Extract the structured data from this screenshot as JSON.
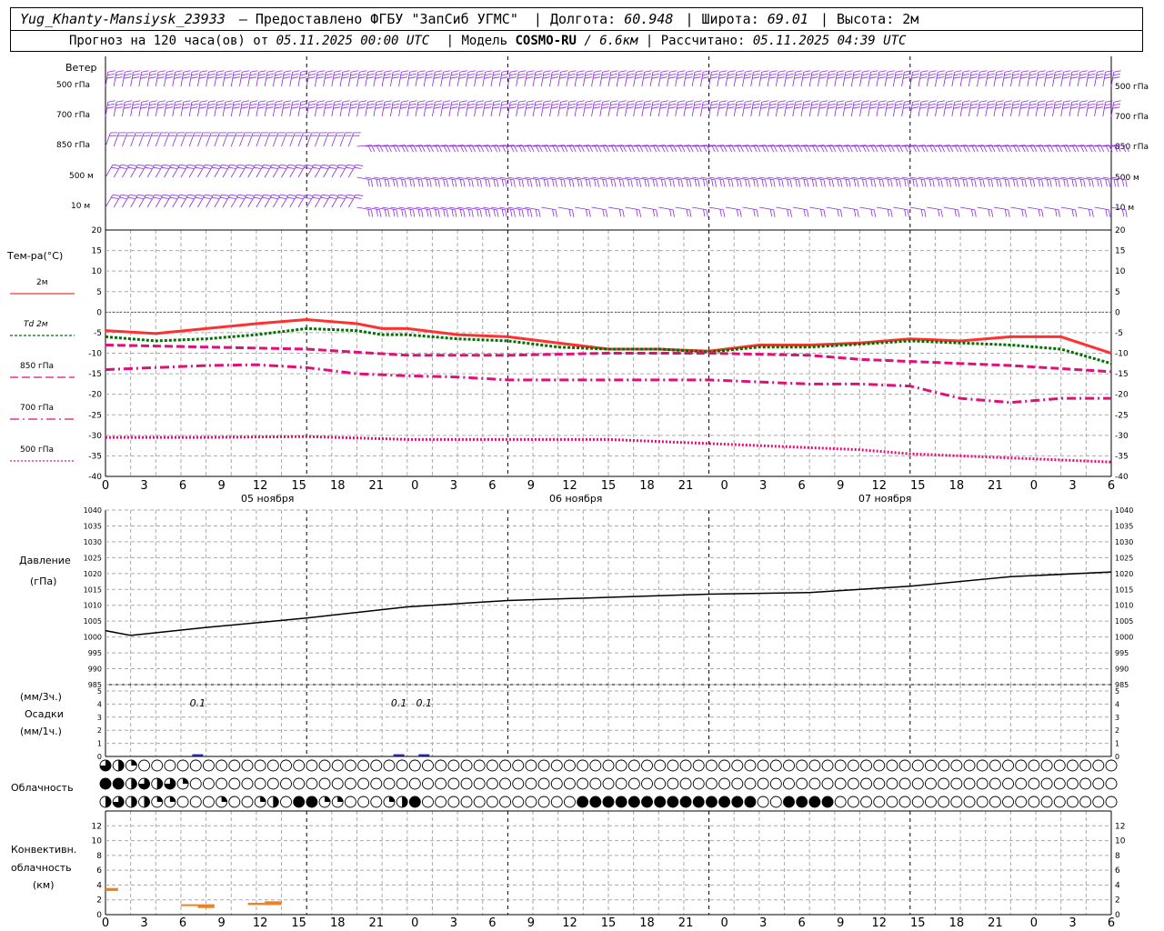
{
  "header": {
    "station": "Yug_Khanty-Mansiysk_23933",
    "provider": "— Предоставлено ФГБУ \"ЗапСиб УГМС\"",
    "lon_label": "Долгота:",
    "lon": "60.948",
    "lat_label": "Широта:",
    "lat": "69.01",
    "alt_label": "Высота: 2м",
    "forecast_prefix": "Прогноз на 120 часа(ов) от",
    "start": "05.11.2025 00:00 UTC",
    "model_label": "Модель",
    "model": "COSMO-RU",
    "resolution": "/ 6.6км",
    "computed_label": "Рассчитано:",
    "computed": "05.11.2025 04:39 UTC"
  },
  "labels": {
    "wind_title": "Ветер",
    "wind_levels": [
      "500 гПа",
      "700 гПа",
      "850 гПа",
      "500 м",
      "10  м"
    ],
    "temp_title": "Тем-ра(°С)",
    "legend": [
      {
        "text": "2м",
        "color": "#ff3030",
        "dash": ""
      },
      {
        "text": "Td  2м",
        "color": "#007000",
        "dash": "3,2"
      },
      {
        "text": "850 гПа",
        "color": "#e0107a",
        "dash": "9,4"
      },
      {
        "text": "700 гПа",
        "color": "#e0107a",
        "dash": "10,4,2,4"
      },
      {
        "text": "500 гПа",
        "color": "#e0107a",
        "dash": "2,2"
      }
    ],
    "pressure_title": "Давление",
    "pressure_unit": "(гПа)",
    "precip_unit_3h": "(мм/3ч.)",
    "precip_title": "Осадки",
    "precip_unit_1h": "(мм/1ч.)",
    "cloud_title": "Облачность",
    "conv_title_1": "Конвективн.",
    "conv_title_2": "облачность",
    "conv_unit": "(км)",
    "dates": [
      "05 ноября",
      "06 ноября",
      "07 ноября"
    ]
  },
  "chart_data": [
    {
      "type": "barbs",
      "title": "Ветер",
      "levels": [
        "500 гПа",
        "700 гПа",
        "850 гПа",
        "500 м",
        "10  м"
      ],
      "hours": [
        0,
        120
      ],
      "color": "#8a2be2"
    },
    {
      "type": "line",
      "title": "Тем-ра(°С)",
      "x_ticks": [
        "0",
        "3",
        "6",
        "9",
        "12",
        "15",
        "18",
        "21",
        "0",
        "3",
        "6",
        "9",
        "12",
        "15",
        "18",
        "21",
        "0",
        "3",
        "6",
        "9",
        "12",
        "15",
        "18",
        "21",
        "0",
        "3",
        "6"
      ],
      "ylim": [
        -40,
        20
      ],
      "y_ticks": [
        -40,
        -35,
        -30,
        -25,
        -20,
        -15,
        -10,
        -5,
        0,
        5,
        10,
        15,
        20
      ],
      "series": [
        {
          "name": "2м",
          "color": "#ff3030",
          "dash": "",
          "x": [
            0,
            6,
            12,
            18,
            24,
            30,
            33,
            36,
            42,
            48,
            54,
            60,
            66,
            72,
            78,
            84,
            90,
            96,
            102,
            108,
            114,
            120
          ],
          "values": [
            -4.5,
            -5.2,
            -4,
            -2.8,
            -1.8,
            -2.8,
            -4,
            -4,
            -5.5,
            -6,
            -7.5,
            -9,
            -9,
            -9.5,
            -8,
            -8,
            -7.5,
            -6.5,
            -7,
            -6,
            -6,
            -10
          ]
        },
        {
          "name": "Td  2м",
          "color": "#007000",
          "dash": "3,2",
          "x": [
            0,
            6,
            12,
            18,
            24,
            30,
            33,
            36,
            42,
            48,
            54,
            60,
            66,
            72,
            78,
            84,
            90,
            96,
            102,
            108,
            114,
            120
          ],
          "values": [
            -6,
            -7,
            -6.5,
            -5.5,
            -4,
            -4.5,
            -5.5,
            -5.5,
            -6.5,
            -7,
            -8.5,
            -9,
            -9,
            -9.7,
            -8.5,
            -8.5,
            -7.8,
            -7,
            -7.5,
            -8,
            -9,
            -12.5
          ]
        },
        {
          "name": "850 гПа",
          "color": "#e0107a",
          "dash": "9,4",
          "x": [
            0,
            12,
            24,
            36,
            48,
            60,
            72,
            84,
            90,
            96,
            108,
            120
          ],
          "values": [
            -8,
            -8.5,
            -9,
            -10.5,
            -10.5,
            -10,
            -10,
            -10.5,
            -11.5,
            -12,
            -13,
            -14.5
          ]
        },
        {
          "name": "700 гПа",
          "color": "#e0107a",
          "dash": "10,4,2,4",
          "x": [
            0,
            6,
            12,
            18,
            24,
            30,
            36,
            42,
            48,
            60,
            72,
            84,
            90,
            96,
            102,
            108,
            114,
            120
          ],
          "values": [
            -14,
            -13.5,
            -13,
            -12.8,
            -13.5,
            -15,
            -15.5,
            -15.8,
            -16.5,
            -16.5,
            -16.5,
            -17.5,
            -17.5,
            -18,
            -21,
            -22,
            -21,
            -21
          ]
        },
        {
          "name": "500 гПа",
          "color": "#e0107a",
          "dash": "2,2",
          "x": [
            0,
            12,
            24,
            36,
            48,
            60,
            72,
            84,
            90,
            96,
            108,
            120
          ],
          "values": [
            -30.5,
            -30.5,
            -30.3,
            -31,
            -31,
            -31,
            -32,
            -33,
            -33.5,
            -34.5,
            -35.5,
            -36.5
          ]
        }
      ]
    },
    {
      "type": "line",
      "title": "Давление",
      "ylabel": "(гПа)",
      "ylim": [
        985,
        1040
      ],
      "y_ticks": [
        985,
        990,
        995,
        1000,
        1005,
        1010,
        1015,
        1020,
        1025,
        1030,
        1035,
        1040
      ],
      "series": [
        {
          "name": "",
          "color": "#000000",
          "x": [
            0,
            3,
            12,
            24,
            36,
            48,
            60,
            72,
            84,
            96,
            108,
            120
          ],
          "values": [
            1002,
            1000.5,
            1003,
            1006,
            1009.5,
            1011.5,
            1012.5,
            1013.5,
            1014,
            1016,
            1019,
            1020.5
          ]
        }
      ]
    },
    {
      "type": "bar",
      "title": "Осадки",
      "ylim": [
        0,
        5
      ],
      "y_ticks": [
        0,
        1,
        2,
        3,
        4,
        5
      ],
      "bars": [
        {
          "x": 11,
          "value": 0.1,
          "label": "0.1"
        },
        {
          "x": 35,
          "value": 0.1,
          "label": "0.1"
        },
        {
          "x": 38,
          "value": 0.1,
          "label": "0.1"
        }
      ]
    },
    {
      "type": "symbols",
      "title": "Облачность",
      "rows": 3,
      "note": "circle symbols per hour; fill 0=clear, 4=overcast"
    },
    {
      "type": "bar",
      "title": "Конвективн. облачность",
      "ylabel": "(км)",
      "ylim": [
        0,
        13
      ],
      "y_ticks": [
        0,
        2,
        4,
        6,
        8,
        10,
        12
      ],
      "bars": [
        {
          "x0": 0,
          "x1": 1.5,
          "base": 3.2,
          "top": 3.6
        },
        {
          "x0": 9,
          "x1": 11,
          "base": 1.2,
          "top": 1.4
        },
        {
          "x0": 11,
          "x1": 13,
          "base": 0.9,
          "top": 1.4
        },
        {
          "x0": 17,
          "x1": 19,
          "base": 1.3,
          "top": 1.6
        },
        {
          "x0": 19,
          "x1": 21,
          "base": 1.3,
          "top": 1.8
        }
      ],
      "color": "#f08020"
    }
  ]
}
